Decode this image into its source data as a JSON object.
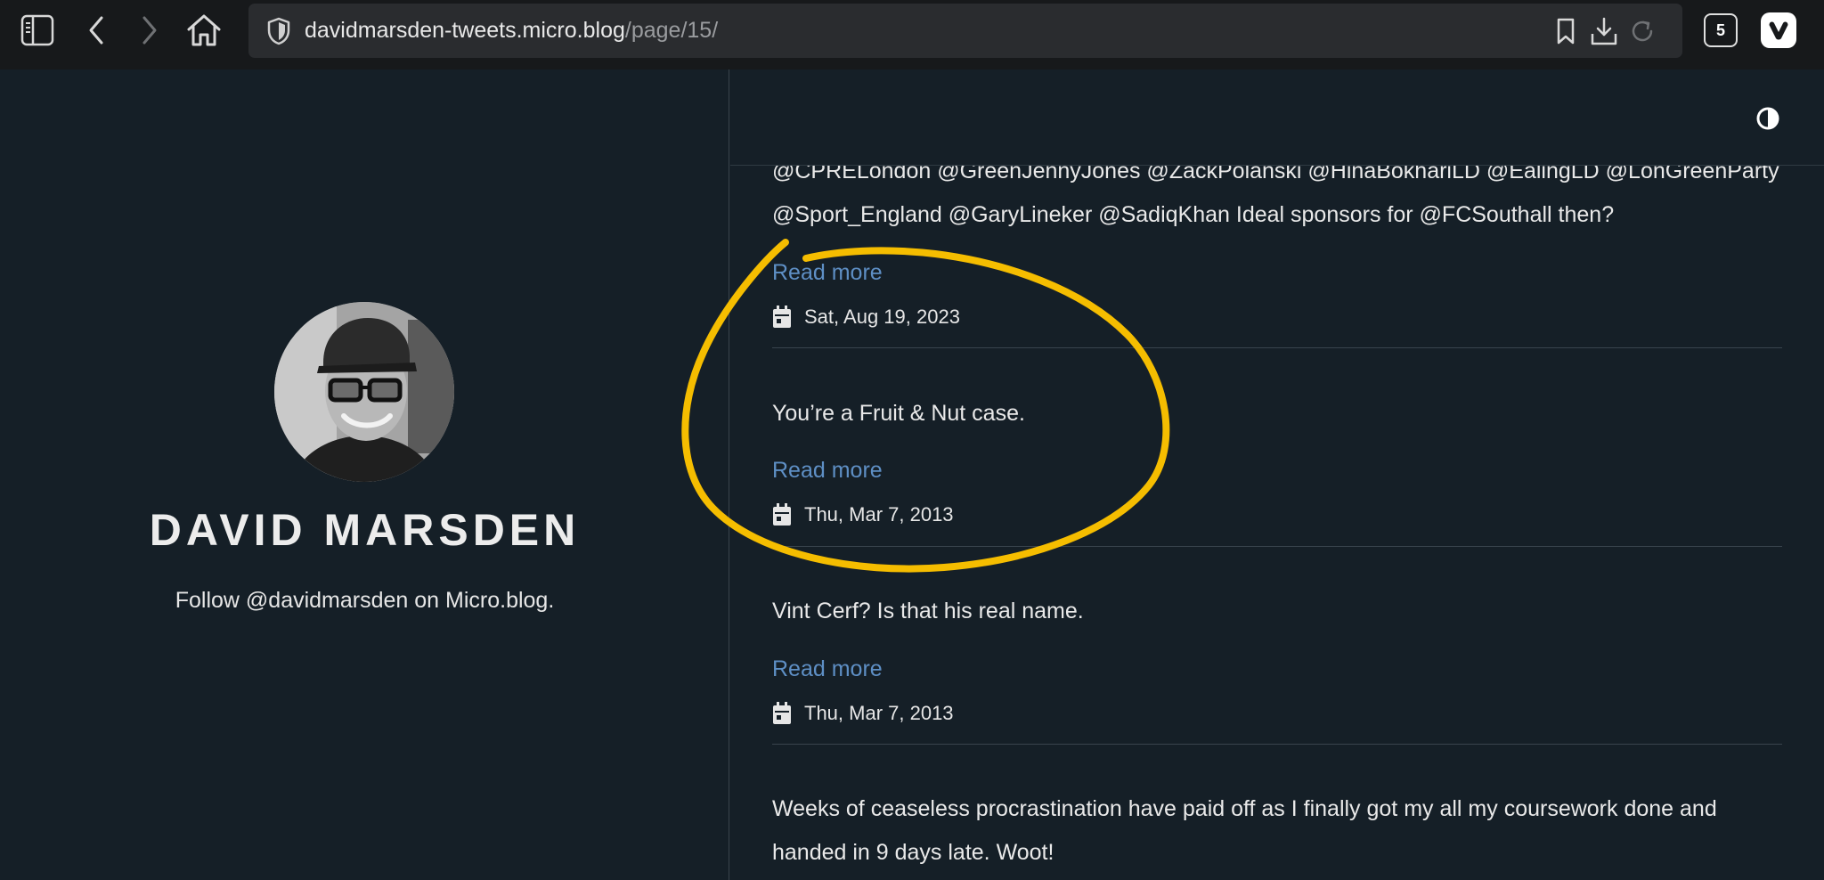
{
  "browser": {
    "url_domain": "davidmarsden-tweets.micro.blog",
    "url_path": "/page/15/",
    "tab_count": "5"
  },
  "profile": {
    "name": "DAVID MARSDEN",
    "follow_text": "Follow @davidmarsden on Micro.blog."
  },
  "posts": [
    {
      "lines": [
        "@CPRELondon @GreenJennyJones @ZackPolanski @HinaBokhariLD @EalingLD @LonGreenParty",
        "@Sport_England @GaryLineker @SadiqKhan Ideal sponsors for @FCSouthall then?"
      ],
      "read_more": "Read more",
      "date": "Sat, Aug 19, 2023"
    },
    {
      "lines": [
        "You’re a Fruit & Nut case."
      ],
      "read_more": "Read more",
      "date": "Thu, Mar 7, 2013"
    },
    {
      "lines": [
        "Vint Cerf? Is that his real name."
      ],
      "read_more": "Read more",
      "date": "Thu, Mar 7, 2013"
    },
    {
      "lines": [
        "Weeks of ceaseless procrastination have paid off as I finally got my all my coursework done and",
        "handed in 9 days late. Woot!"
      ]
    }
  ],
  "icons": {
    "sidebar": "sidebar-panel-icon",
    "back": "chevron-left-icon",
    "forward": "chevron-right-icon",
    "home": "home-icon",
    "shield": "shield-icon",
    "bookmark": "bookmark-icon",
    "download": "download-icon",
    "reload": "reload-icon",
    "calendar": "calendar-icon",
    "theme": "contrast-icon"
  },
  "colors": {
    "link": "#5e8fc5",
    "annotation": "#f5bd00"
  }
}
